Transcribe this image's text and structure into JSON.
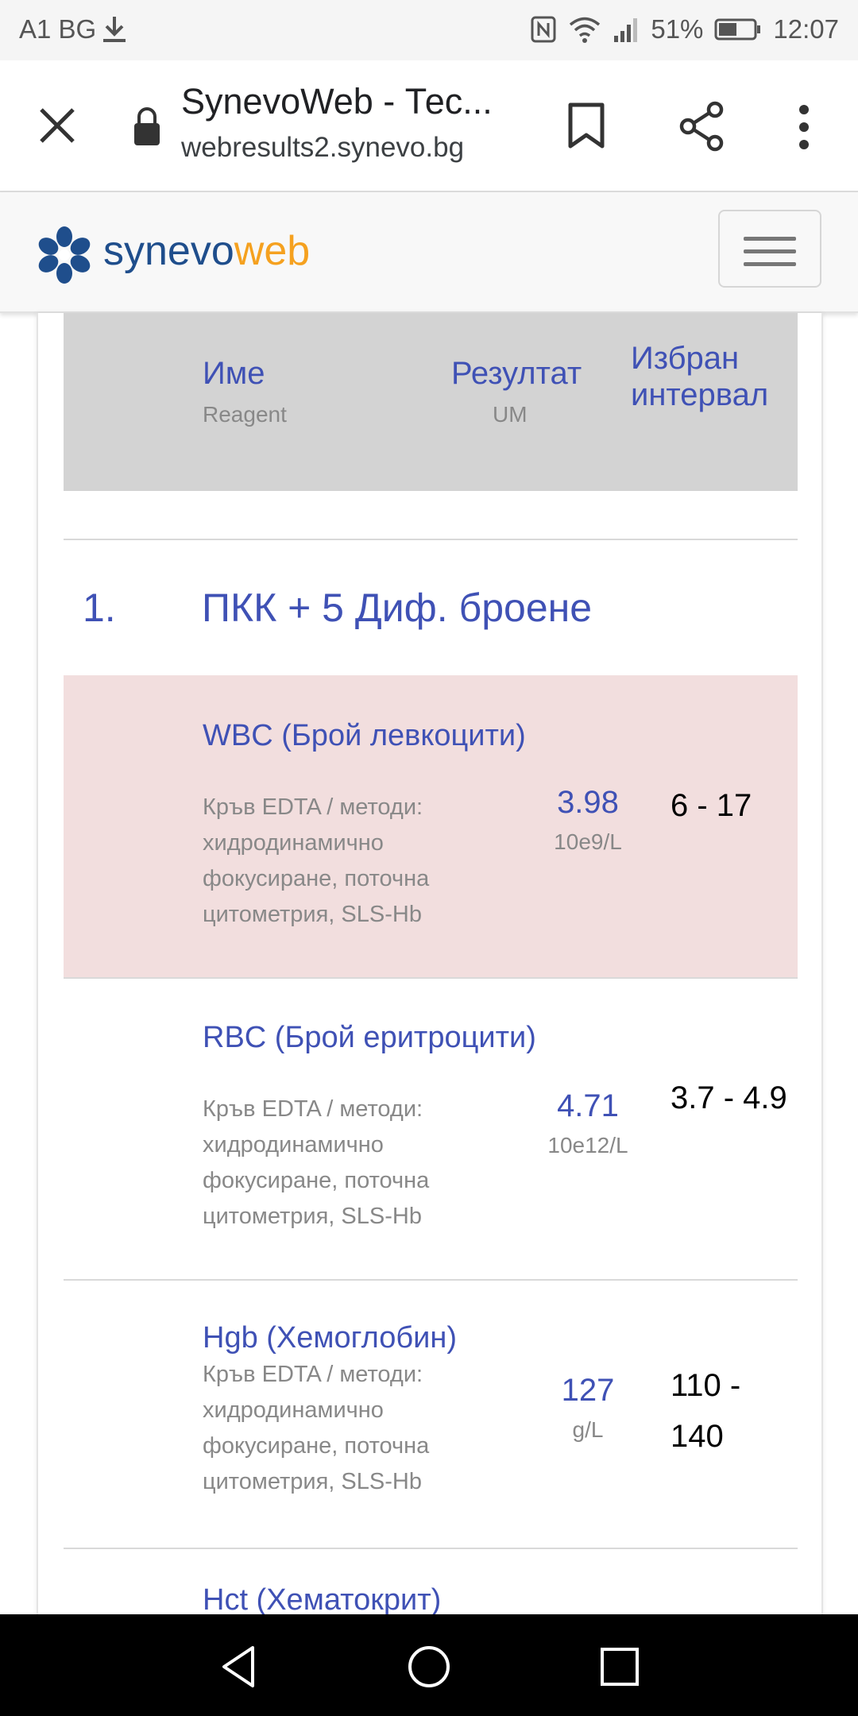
{
  "status": {
    "carrier": "A1 BG",
    "battery": "51%",
    "time": "12:07"
  },
  "browser": {
    "title": "SynevoWeb - Тес...",
    "url": "webresults2.synevo.bg"
  },
  "site": {
    "brand_part1": "synevo",
    "brand_part2": "web",
    "brand_color": "#1f4e8c",
    "accent_color": "#f5a11f"
  },
  "table_header": {
    "name": "Име",
    "name_sub": "Reagent",
    "result": "Резултат",
    "result_sub": "UM",
    "interval": "Избран интервал"
  },
  "group": {
    "number": "1.",
    "title": "ПКК + 5 Диф. броене"
  },
  "rows": [
    {
      "name": "WBC (Брой левкоцити)",
      "description": "Кръв EDTA / методи: хидродинамично фокусиране, поточна цитометрия, SLS-Hb",
      "value": "3.98",
      "unit": "10e9/L",
      "range": "6 - 17",
      "flagged": true
    },
    {
      "name": "RBC (Брой еритроцити)",
      "description": "Кръв EDTA / методи: хидродинамично фокусиране, поточна цитометрия, SLS-Hb",
      "value": "4.71",
      "unit": "10e12/L",
      "range": "3.7 - 4.9",
      "flagged": false
    },
    {
      "name": "Hgb (Хемоглобин)",
      "description": "Кръв EDTA / методи: хидродинамично фокусиране, поточна цитометрия, SLS-Hb",
      "value": "127",
      "unit": "g/L",
      "range": "110 - 140",
      "flagged": false
    },
    {
      "name": "Hct (Хематокрит)"
    }
  ],
  "icons": {
    "close": "close-icon",
    "lock": "lock-icon",
    "bookmark": "bookmark-icon",
    "share": "share-icon",
    "more": "more-vert-icon",
    "menu": "hamburger-icon",
    "back": "back-triangle-icon",
    "home": "home-circle-icon",
    "recents": "recents-square-icon"
  }
}
